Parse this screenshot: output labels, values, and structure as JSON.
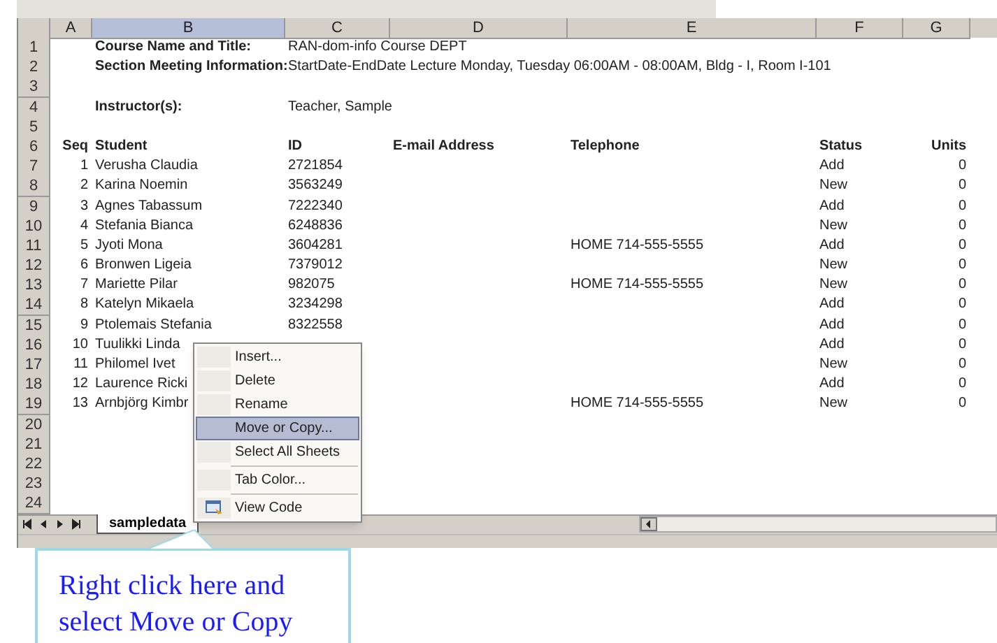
{
  "columns": [
    {
      "label": "A",
      "selected": false
    },
    {
      "label": "B",
      "selected": true
    },
    {
      "label": "C",
      "selected": false
    },
    {
      "label": "D",
      "selected": false
    },
    {
      "label": "E",
      "selected": false
    },
    {
      "label": "F",
      "selected": false
    },
    {
      "label": "G",
      "selected": false
    }
  ],
  "rows": [
    {
      "number": "1",
      "cells": {
        "B": {
          "text": "Course Name and Title:",
          "bold": true
        },
        "C": {
          "text": "RAN-dom-info Course DEPT",
          "bold": false
        }
      }
    },
    {
      "number": "2",
      "cells": {
        "B": {
          "text": "Section Meeting Information:",
          "bold": true
        },
        "C": {
          "text": "StartDate-EndDate Lecture Monday, Tuesday 06:00AM - 08:00AM, Bldg - I, Room I-101",
          "bold": false
        }
      }
    },
    {
      "number": "3",
      "cells": {}
    },
    {
      "number": "4",
      "cells": {
        "B": {
          "text": "Instructor(s):",
          "bold": true
        },
        "C": {
          "text": "Teacher, Sample",
          "bold": false
        }
      }
    },
    {
      "number": "5",
      "cells": {}
    },
    {
      "number": "6",
      "cells": {
        "A": {
          "text": "Seq",
          "bold": true
        },
        "B": {
          "text": "Student",
          "bold": true
        },
        "C": {
          "text": "ID",
          "bold": true
        },
        "D": {
          "text": "E-mail Address",
          "bold": true
        },
        "E": {
          "text": "Telephone",
          "bold": true
        },
        "F": {
          "text": "Status",
          "bold": true
        },
        "G": {
          "text": "Units",
          "bold": true
        }
      }
    },
    {
      "number": "7",
      "cells": {
        "A": {
          "text": "1",
          "bold": false
        },
        "B": {
          "text": "Verusha Claudia",
          "bold": false
        },
        "C": {
          "text": "2721854",
          "bold": false
        },
        "F": {
          "text": "Add",
          "bold": false
        },
        "G": {
          "text": "0",
          "bold": false
        }
      }
    },
    {
      "number": "8",
      "cells": {
        "A": {
          "text": "2",
          "bold": false
        },
        "B": {
          "text": "Karina Noemin",
          "bold": false
        },
        "C": {
          "text": "3563249",
          "bold": false
        },
        "F": {
          "text": "New",
          "bold": false
        },
        "G": {
          "text": "0",
          "bold": false
        }
      }
    },
    {
      "number": "9",
      "cells": {
        "A": {
          "text": "3",
          "bold": false
        },
        "B": {
          "text": "Agnes Tabassum",
          "bold": false
        },
        "C": {
          "text": "7222340",
          "bold": false
        },
        "F": {
          "text": "Add",
          "bold": false
        },
        "G": {
          "text": "0",
          "bold": false
        }
      }
    },
    {
      "number": "10",
      "cells": {
        "A": {
          "text": "4",
          "bold": false
        },
        "B": {
          "text": "Stefania Bianca",
          "bold": false
        },
        "C": {
          "text": "6248836",
          "bold": false
        },
        "F": {
          "text": "New",
          "bold": false
        },
        "G": {
          "text": "0",
          "bold": false
        }
      }
    },
    {
      "number": "11",
      "cells": {
        "A": {
          "text": "5",
          "bold": false
        },
        "B": {
          "text": "Jyoti Mona",
          "bold": false
        },
        "C": {
          "text": "3604281",
          "bold": false
        },
        "E": {
          "text": "HOME 714-555-5555",
          "bold": false
        },
        "F": {
          "text": "Add",
          "bold": false
        },
        "G": {
          "text": "0",
          "bold": false
        }
      }
    },
    {
      "number": "12",
      "cells": {
        "A": {
          "text": "6",
          "bold": false
        },
        "B": {
          "text": "Bronwen Ligeia",
          "bold": false
        },
        "C": {
          "text": "7379012",
          "bold": false
        },
        "F": {
          "text": "New",
          "bold": false
        },
        "G": {
          "text": "0",
          "bold": false
        }
      }
    },
    {
      "number": "13",
      "cells": {
        "A": {
          "text": "7",
          "bold": false
        },
        "B": {
          "text": "Mariette Pilar",
          "bold": false
        },
        "C": {
          "text": "982075",
          "bold": false
        },
        "E": {
          "text": "HOME 714-555-5555",
          "bold": false
        },
        "F": {
          "text": "New",
          "bold": false
        },
        "G": {
          "text": "0",
          "bold": false
        }
      }
    },
    {
      "number": "14",
      "cells": {
        "A": {
          "text": "8",
          "bold": false
        },
        "B": {
          "text": "Katelyn Mikaela",
          "bold": false
        },
        "C": {
          "text": "3234298",
          "bold": false
        },
        "F": {
          "text": "Add",
          "bold": false
        },
        "G": {
          "text": "0",
          "bold": false
        }
      }
    },
    {
      "number": "15",
      "cells": {
        "A": {
          "text": "9",
          "bold": false
        },
        "B": {
          "text": "Ptolemais Stefania",
          "bold": false
        },
        "C": {
          "text": "8322558",
          "bold": false
        },
        "F": {
          "text": "Add",
          "bold": false
        },
        "G": {
          "text": "0",
          "bold": false
        }
      }
    },
    {
      "number": "16",
      "cells": {
        "A": {
          "text": "10",
          "bold": false
        },
        "B": {
          "text": "Tuulikki Linda",
          "bold": false
        },
        "F": {
          "text": "Add",
          "bold": false
        },
        "G": {
          "text": "0",
          "bold": false
        }
      }
    },
    {
      "number": "17",
      "cells": {
        "A": {
          "text": "11",
          "bold": false
        },
        "B": {
          "text": "Philomel Ivet",
          "bold": false
        },
        "F": {
          "text": "New",
          "bold": false
        },
        "G": {
          "text": "0",
          "bold": false
        }
      }
    },
    {
      "number": "18",
      "cells": {
        "A": {
          "text": "12",
          "bold": false
        },
        "B": {
          "text": "Laurence Ricki",
          "bold": false
        },
        "F": {
          "text": "Add",
          "bold": false
        },
        "G": {
          "text": "0",
          "bold": false
        }
      }
    },
    {
      "number": "19",
      "cells": {
        "A": {
          "text": "13",
          "bold": false
        },
        "B": {
          "text": "Arnbjörg Kimbr",
          "bold": false
        },
        "E": {
          "text": "HOME 714-555-5555",
          "bold": false
        },
        "F": {
          "text": "New",
          "bold": false
        },
        "G": {
          "text": "0",
          "bold": false
        }
      }
    },
    {
      "number": "20",
      "cells": {}
    },
    {
      "number": "21",
      "cells": {}
    },
    {
      "number": "22",
      "cells": {}
    },
    {
      "number": "23",
      "cells": {}
    },
    {
      "number": "24",
      "cells": {}
    }
  ],
  "context_menu": [
    {
      "kind": "item",
      "label": "Insert...",
      "selected": false,
      "has_icon": false
    },
    {
      "kind": "item",
      "label": "Delete",
      "selected": false,
      "has_icon": false
    },
    {
      "kind": "item",
      "label": "Rename",
      "selected": false,
      "has_icon": false
    },
    {
      "kind": "item",
      "label": "Move or Copy...",
      "selected": true,
      "has_icon": false
    },
    {
      "kind": "item",
      "label": "Select All Sheets",
      "selected": false,
      "has_icon": false
    },
    {
      "kind": "separator"
    },
    {
      "kind": "item",
      "label": "Tab Color...",
      "selected": false,
      "has_icon": false
    },
    {
      "kind": "separator"
    },
    {
      "kind": "item",
      "label": "View Code",
      "selected": false,
      "has_icon": true
    }
  ],
  "sheet_tabs": [
    {
      "label": "sampledata",
      "selected": true
    }
  ],
  "callout": {
    "text": "Right click here and select Move or Copy"
  }
}
